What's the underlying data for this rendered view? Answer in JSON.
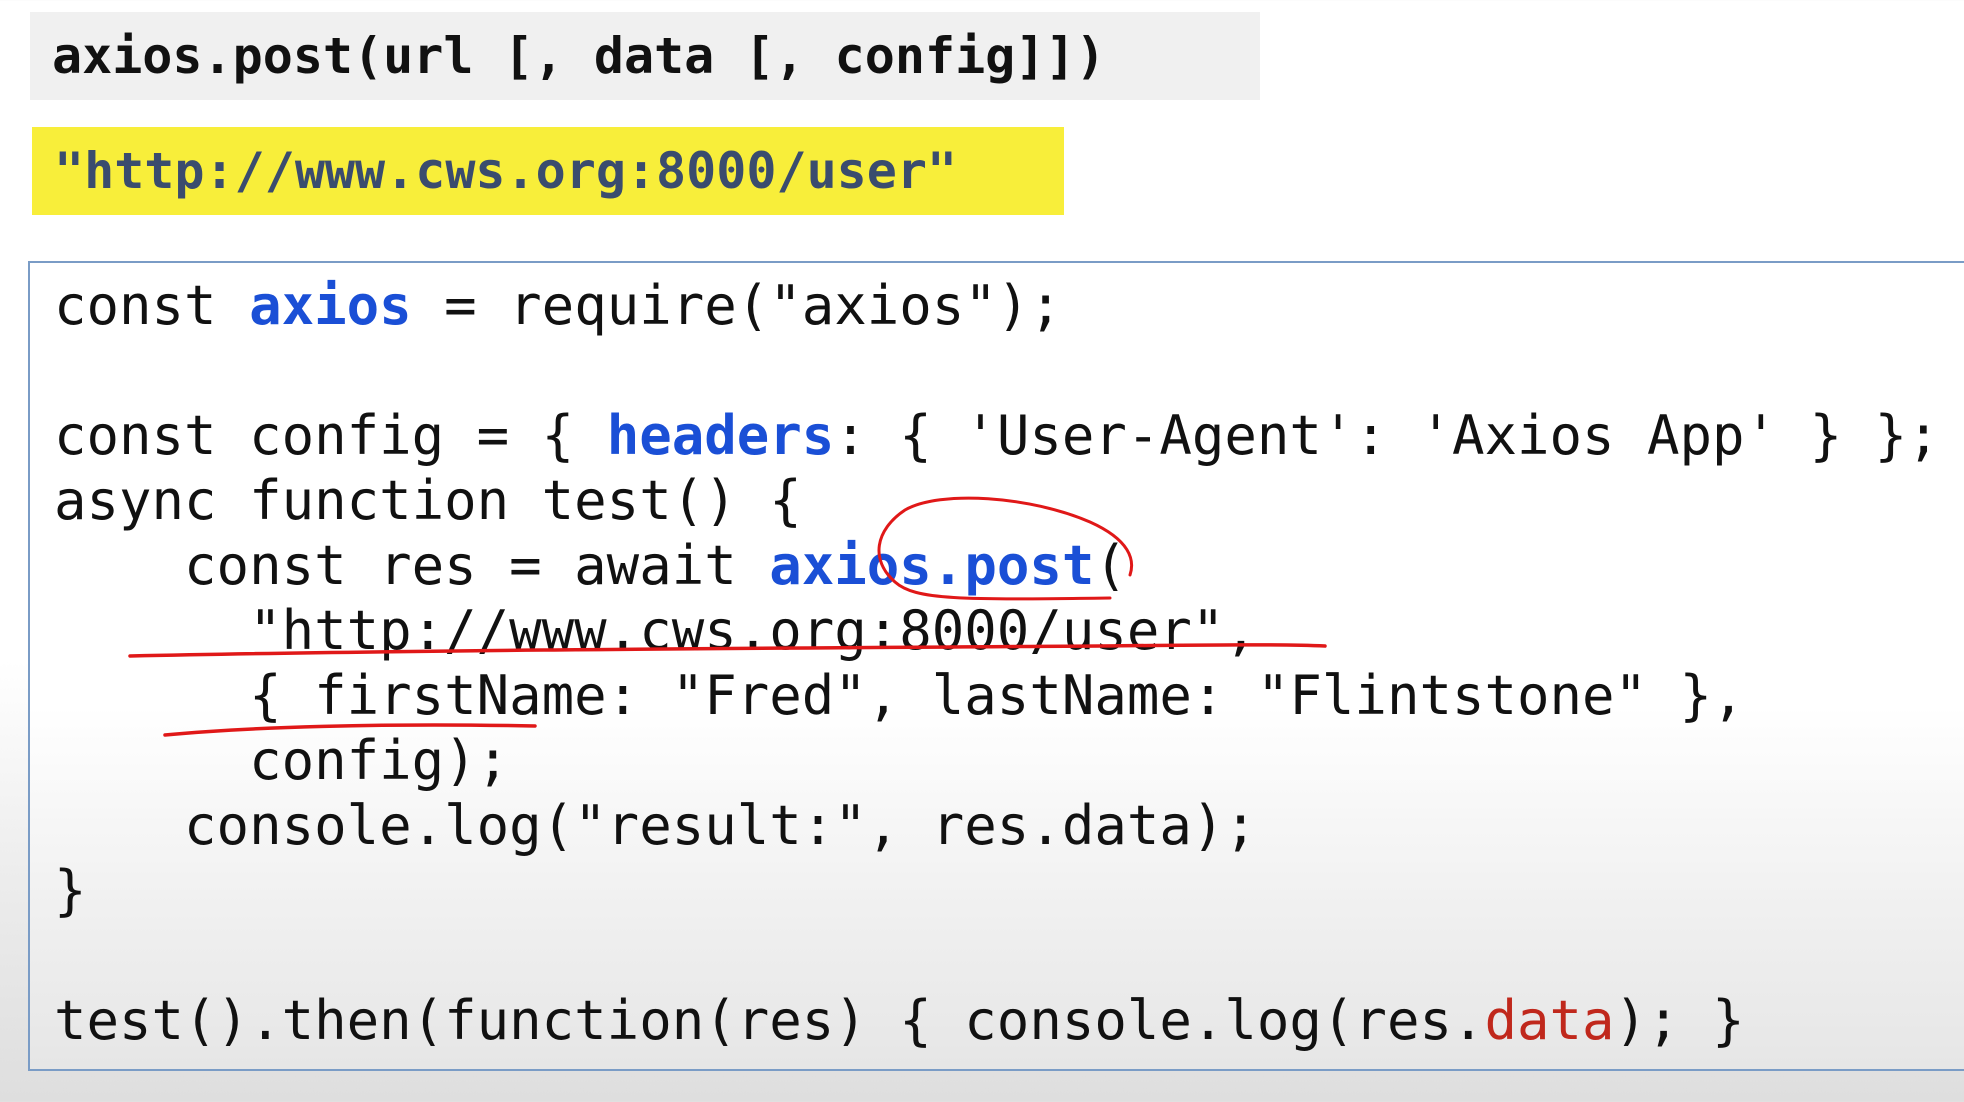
{
  "signature": "axios.post(url [, data [, config]])",
  "url_banner": "\"http://www.cws.org:8000/user\"",
  "code_lines": [
    [
      {
        "t": "const "
      },
      {
        "t": "axios",
        "c": "blue"
      },
      {
        "t": " = require(\"axios\");"
      }
    ],
    [],
    [
      {
        "t": "const config = { "
      },
      {
        "t": "headers",
        "c": "blue"
      },
      {
        "t": ": { 'User-Agent': 'Axios App' } };"
      }
    ],
    [
      {
        "t": "async function test() {"
      }
    ],
    [
      {
        "t": "    const res = await "
      },
      {
        "t": "axios.post",
        "c": "blue"
      },
      {
        "t": "("
      }
    ],
    [
      {
        "t": "      \"http://www.cws.org:8000/user\","
      }
    ],
    [
      {
        "t": "      { firstName: \"Fred\", lastName: \"Flintstone\" },"
      }
    ],
    [
      {
        "t": "      config);"
      }
    ],
    [
      {
        "t": "    console.log(\"result:\", res.data);"
      }
    ],
    [
      {
        "t": "}"
      }
    ],
    [],
    [
      {
        "t": "test().then(function(res) { console.log(res."
      },
      {
        "t": "data",
        "c": "red"
      },
      {
        "t": "); }"
      }
    ]
  ],
  "colors": {
    "keyword_blue": "#1a4fd6",
    "keyword_red": "#c0281c",
    "banner_yellow": "#f8ee3a",
    "annotation_red": "#e01818"
  }
}
